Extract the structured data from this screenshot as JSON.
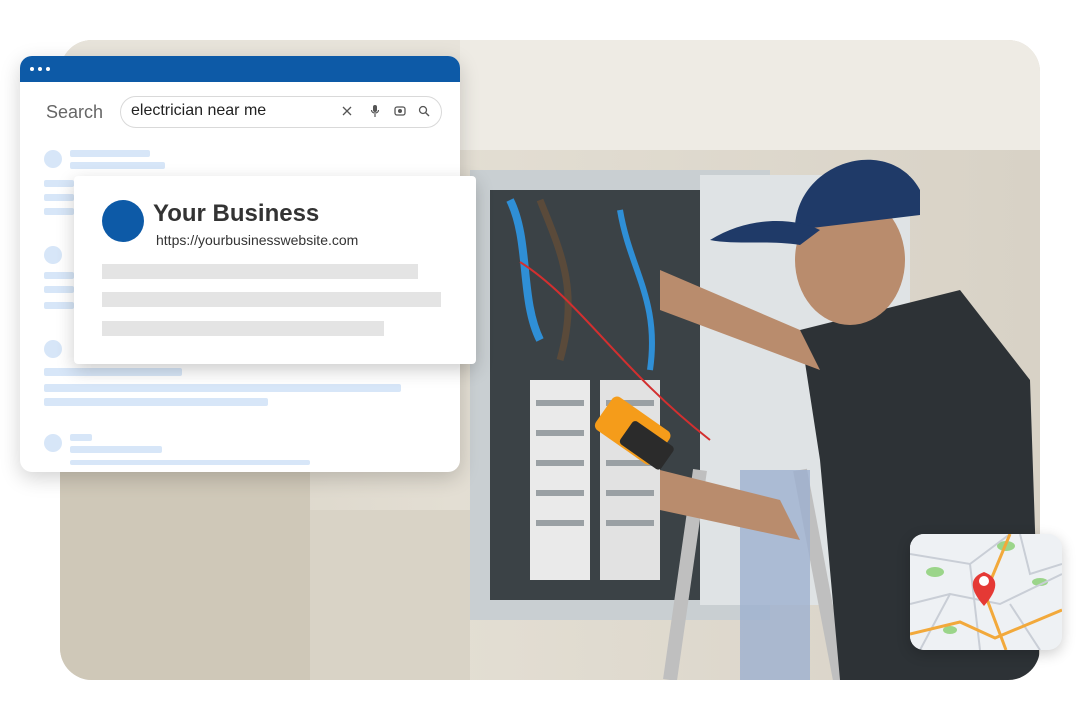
{
  "search": {
    "label": "Search",
    "query": "electrician near me"
  },
  "result": {
    "business_name": "Your Business",
    "url": "https://yourbusinesswebsite.com"
  },
  "icons": {
    "clear": "close-icon",
    "voice": "microphone-icon",
    "lens": "camera-search-icon",
    "search": "search-icon",
    "map_pin": "map-pin-icon"
  },
  "colors": {
    "brand_blue": "#0d5aa7",
    "placeholder_blue": "#d7e6f8",
    "placeholder_gray": "#e4e4e4",
    "map_pin_red": "#e53935",
    "map_route": "#f2a93b"
  }
}
